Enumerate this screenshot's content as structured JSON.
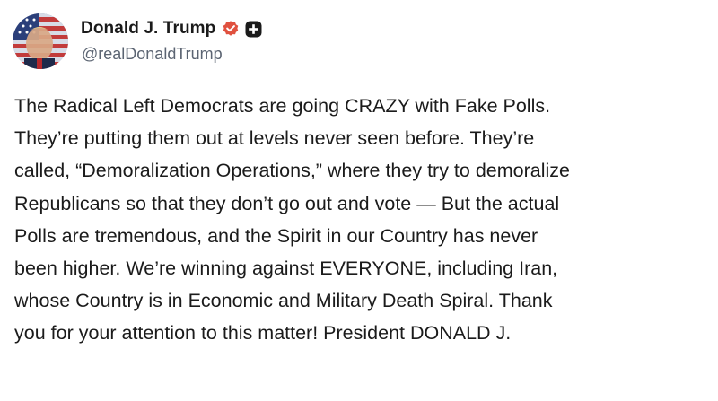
{
  "author": {
    "display_name": "Donald J. Trump",
    "handle": "@realDonaldTrump",
    "avatar_icon": "profile-photo-flag",
    "verified_icon": "verified-badge-icon",
    "verified_color": "#e0513f",
    "extra_icon": "plus-badge-icon"
  },
  "post": {
    "lines": [
      "The Radical Left Democrats are going CRAZY with Fake Polls.",
      "They’re putting them out at levels never seen before. They’re",
      "called, “Demoralization Operations,” where they try to demoralize",
      "Republicans so that they don’t go out and vote — But the actual",
      "Polls are tremendous, and the Spirit in our Country has never",
      "been higher. We’re winning against EVERYONE, including Iran,",
      "whose Country is in Economic and Military Death Spiral. Thank",
      "you for your attention to this matter! President DONALD J."
    ]
  }
}
